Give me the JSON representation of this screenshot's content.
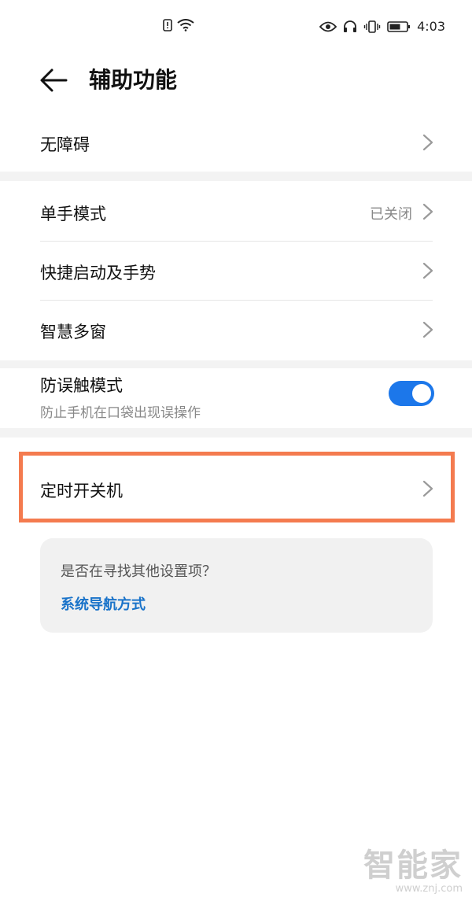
{
  "status_bar": {
    "time": "4:03",
    "left_icons": [
      "alert-icon",
      "wifi-icon"
    ],
    "right_icons": [
      "eye-icon",
      "headphones-icon",
      "vibrate-icon",
      "battery-icon"
    ]
  },
  "header": {
    "back_icon": "arrow-left-icon",
    "title": "辅助功能"
  },
  "list": {
    "accessibility": {
      "label": "无障碍"
    },
    "one_hand": {
      "label": "单手模式",
      "value": "已关闭"
    },
    "shortcuts": {
      "label": "快捷启动及手势"
    },
    "multi_window": {
      "label": "智慧多窗"
    },
    "accidental_touch": {
      "label": "防误触模式",
      "sub": "防止手机在口袋出现误操作",
      "enabled": true
    },
    "scheduled_power": {
      "label": "定时开关机"
    }
  },
  "suggestion": {
    "question": "是否在寻找其他设置项？",
    "link": "系统导航方式"
  },
  "watermark": {
    "logo": "智能家",
    "url": "www.znj.com"
  },
  "colors": {
    "accent": "#1c77ea",
    "link": "#1a73c9",
    "highlight": "#f47b4f"
  }
}
